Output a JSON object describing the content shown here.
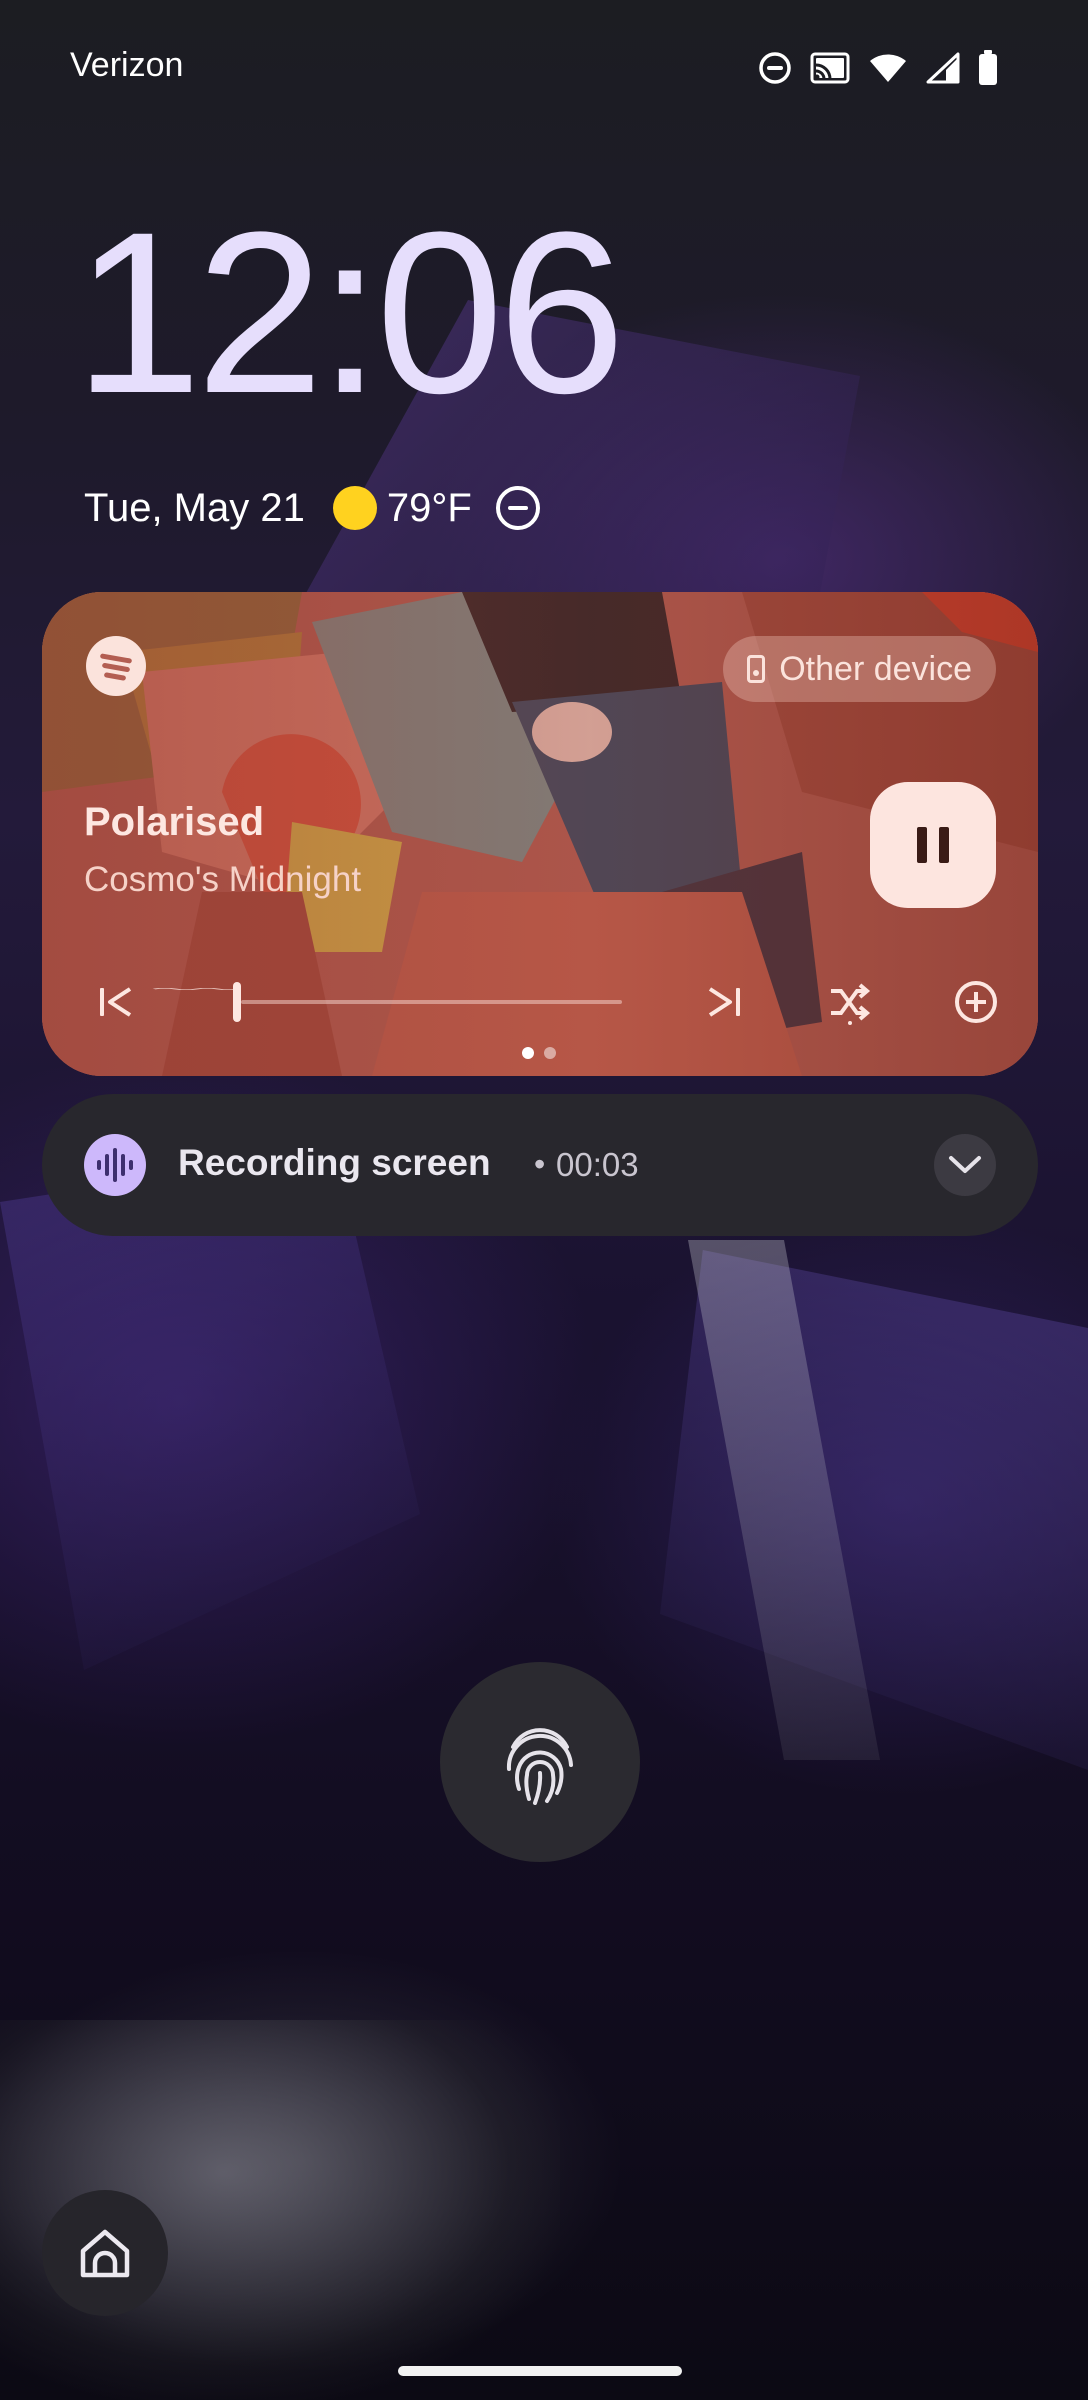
{
  "status_bar": {
    "carrier": "Verizon",
    "icons": [
      "dnd-icon",
      "cast-icon",
      "wifi-icon",
      "cell-signal-icon",
      "battery-icon"
    ]
  },
  "lock_screen": {
    "time": "12:06",
    "date": "Tue, May 21",
    "weather_icon": "sun-icon",
    "temperature": "79°F",
    "dnd_indicator_icon": "dnd-icon"
  },
  "media_player": {
    "app_icon": "spotify-icon",
    "output_device_label": "Other device",
    "track_title": "Polarised",
    "artist": "Cosmo's Midnight",
    "state": "playing",
    "progress": 0.18,
    "controls": [
      "previous-icon",
      "pause-icon",
      "next-icon",
      "shuffle-icon",
      "add-icon"
    ],
    "page_count": 2,
    "active_page": 1,
    "accent_color": "#b35e52"
  },
  "notification": {
    "icon": "sound-wave-icon",
    "title": "Recording screen",
    "separator": "•",
    "elapsed": "00:03"
  },
  "bottom": {
    "fingerprint_icon": "fingerprint-icon",
    "home_icon": "home-icon"
  }
}
